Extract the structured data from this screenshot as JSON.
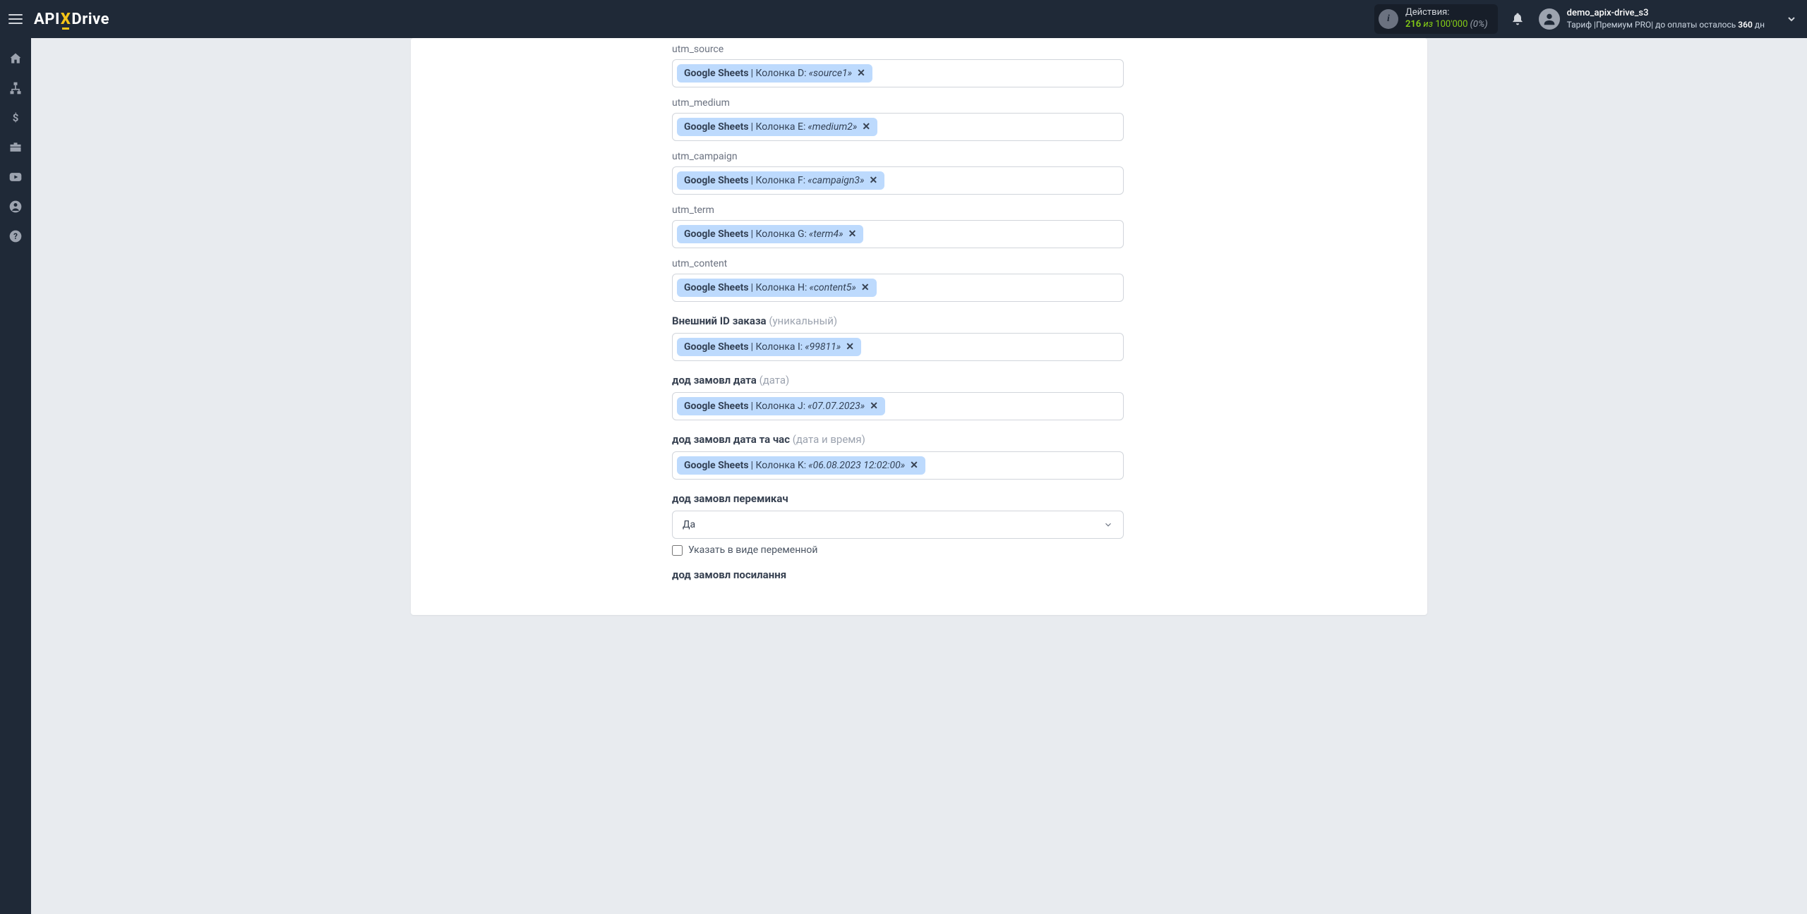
{
  "header": {
    "logo_api": "API",
    "logo_x": "X",
    "logo_drive": "Drive",
    "actions_label": "Действия:",
    "actions_count": "216",
    "actions_of": " из ",
    "actions_total": "100'000",
    "actions_pct": " (0%)",
    "user_name": "demo_apix-drive_s3",
    "user_sub_prefix": "Тариф |Премиум PRO| до оплаты осталось ",
    "user_sub_days": "360",
    "user_sub_suffix": " дн"
  },
  "fields": [
    {
      "label": "utm_source",
      "tag_src": "Google Sheets",
      "tag_mid": " | Колонка D: ",
      "tag_val": "«source1»"
    },
    {
      "label": "utm_medium",
      "tag_src": "Google Sheets",
      "tag_mid": " | Колонка E: ",
      "tag_val": "«medium2»"
    },
    {
      "label": "utm_campaign",
      "tag_src": "Google Sheets",
      "tag_mid": " | Колонка F: ",
      "tag_val": "«campaign3»"
    },
    {
      "label": "utm_term",
      "tag_src": "Google Sheets",
      "tag_mid": " | Колонка G: ",
      "tag_val": "«term4»"
    },
    {
      "label": "utm_content",
      "tag_src": "Google Sheets",
      "tag_mid": " | Колонка H: ",
      "tag_val": "«content5»"
    }
  ],
  "sections": [
    {
      "primary": "Внешний ID заказа",
      "hint": " (уникальный)",
      "tag_src": "Google Sheets",
      "tag_mid": " | Колонка I: ",
      "tag_val": "«99811»"
    },
    {
      "primary": "дод замовл дата",
      "hint": " (дата)",
      "tag_src": "Google Sheets",
      "tag_mid": " | Колонка J: ",
      "tag_val": "«07.07.2023»"
    },
    {
      "primary": "дод замовл дата та час",
      "hint": " (дата и время)",
      "tag_src": "Google Sheets",
      "tag_mid": " | Колонка K: ",
      "tag_val": "«06.08.2023 12:02:00»"
    }
  ],
  "switch": {
    "primary": "дод замовл перемикач",
    "value": "Да",
    "checkbox_label": "Указать в виде переменной"
  },
  "last_label": "дод замовл посилання"
}
